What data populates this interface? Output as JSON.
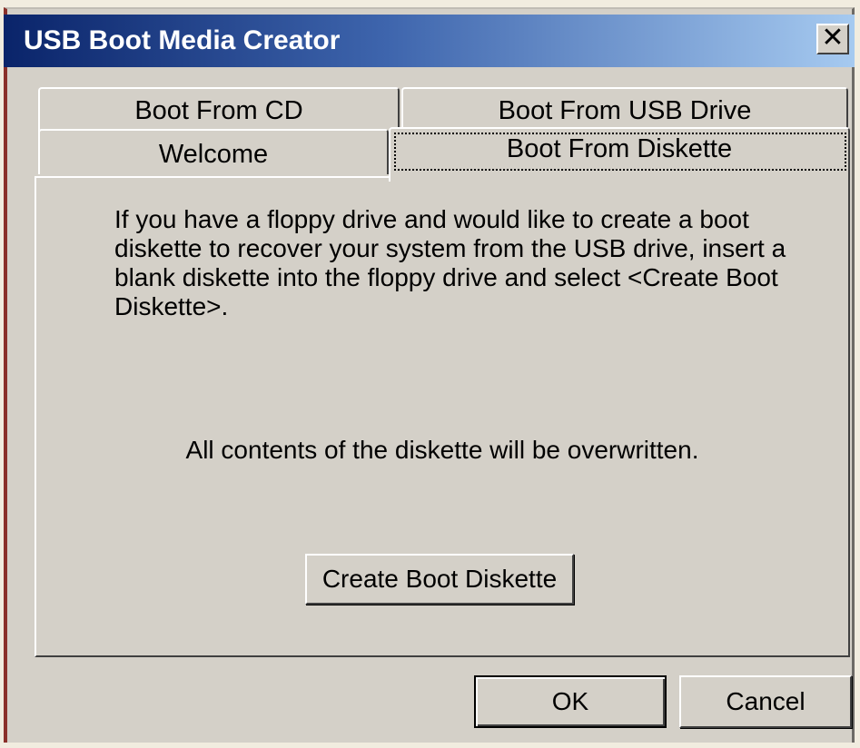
{
  "window": {
    "title": "USB Boot Media Creator",
    "close_glyph": "✕"
  },
  "tabs": [
    {
      "label": "Boot From CD"
    },
    {
      "label": "Boot From USB Drive"
    },
    {
      "label": "Welcome"
    },
    {
      "label": "Boot From Diskette",
      "selected": true
    }
  ],
  "panel": {
    "instructions": "If you have a floppy drive and would like to create a boot diskette to recover your system from the USB drive, insert a blank diskette into the floppy drive and select <Create Boot Diskette>.",
    "warning": "All contents of the diskette will be overwritten.",
    "create_button": "Create Boot Diskette"
  },
  "footer": {
    "ok_label": "OK",
    "cancel_label": "Cancel"
  },
  "colors": {
    "title_start": "#0a246a",
    "title_end": "#a6caf0",
    "face": "#d4d0c8"
  }
}
